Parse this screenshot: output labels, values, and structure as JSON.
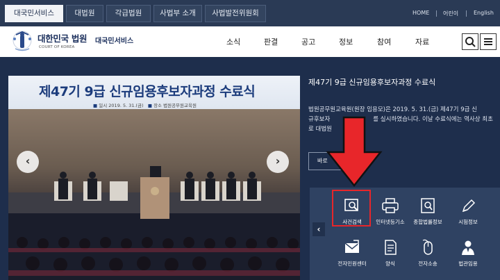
{
  "top_tabs": [
    "대국민서비스",
    "대법원",
    "각급법원",
    "사법부 소개",
    "사법발전위원회"
  ],
  "utility_links": [
    "HOME",
    "어린이",
    "English"
  ],
  "logo": {
    "title": "대한민국 법원",
    "subtitle": "COURT OF KOREA",
    "service": "대국민서비스"
  },
  "gnb": [
    "소식",
    "판결",
    "공고",
    "정보",
    "참여",
    "자료"
  ],
  "header_icons": [
    "search-icon",
    "menu-icon"
  ],
  "slide": {
    "banner_title": "제47기 9급 신규임용후보자과정 수료식",
    "banner_date_label": "일시",
    "banner_date": "2019. 5. 31.(금)",
    "banner_place_label": "장소",
    "banner_place": "법원공무원교육원",
    "prev": "‹",
    "next": "›"
  },
  "news": {
    "title": "제47기 9급 신규임용후보자과정 수료식",
    "body_line1": "법원공무원교육원(원장 임용모)은 2019. 5. 31.(금) 제47기 9급 신",
    "body_line2": "규후보자",
    "body_line2b": "를 실시하였습니다. 이날 수료식에는 역사상 최초",
    "body_line3": "로 대법원",
    "more_label": "바로"
  },
  "quick_menu": {
    "prev": "‹",
    "items": [
      {
        "label": "사건검색",
        "icon": "search-document-icon"
      },
      {
        "label": "인터넷등기소",
        "icon": "printer-icon"
      },
      {
        "label": "종합법률정보",
        "icon": "law-book-icon"
      },
      {
        "label": "시험정보",
        "icon": "pen-icon"
      },
      {
        "label": "전자민원센터",
        "icon": "envelope-icon"
      },
      {
        "label": "양식",
        "icon": "form-document-icon"
      },
      {
        "label": "전자소송",
        "icon": "mouse-icon"
      },
      {
        "label": "법관임용",
        "icon": "judge-icon"
      }
    ]
  },
  "colors": {
    "navy": "#1e2e4c",
    "highlight": "#e8262a"
  }
}
